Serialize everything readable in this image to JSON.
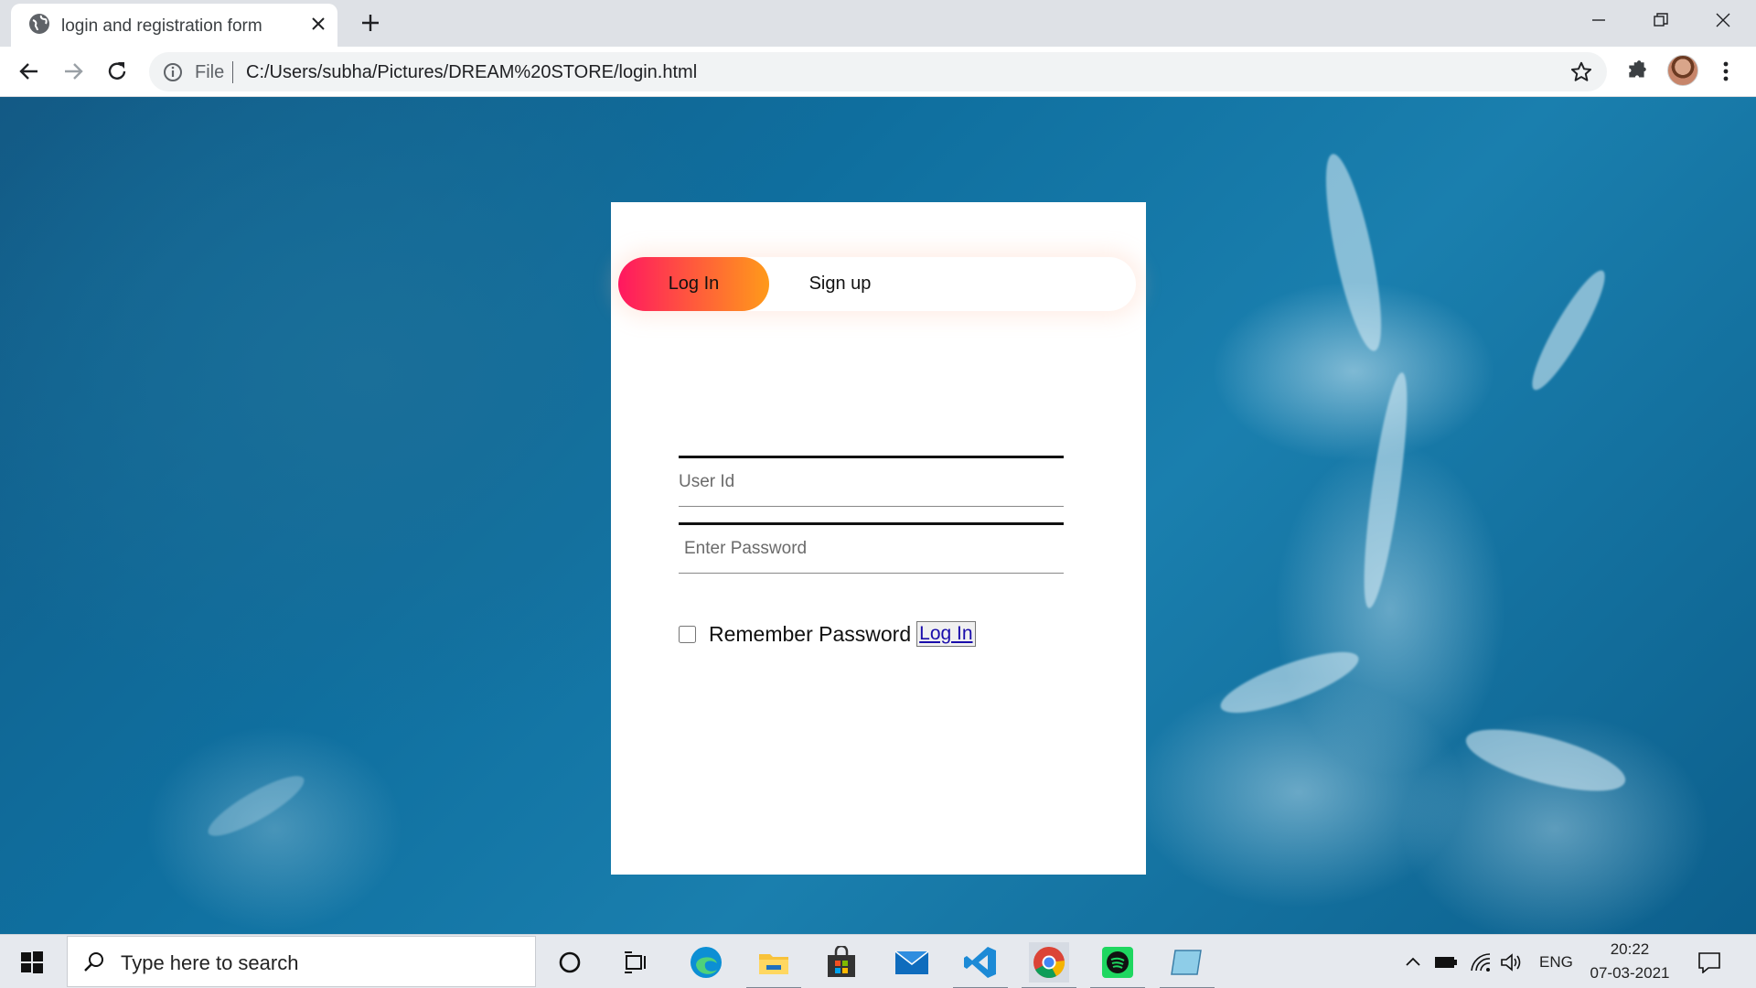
{
  "browser": {
    "tab_title": "login and registration form",
    "address_scheme": "File",
    "address_url": "C:/Users/subha/Pictures/DREAM%20STORE/login.html"
  },
  "page": {
    "toggle": {
      "login_label": "Log In",
      "signup_label": "Sign up"
    },
    "user_placeholder": "User Id",
    "password_placeholder": "Enter Password",
    "remember_label": "Remember Password",
    "login_link": "Log In",
    "colors": {
      "pill_start": "#ff1760",
      "pill_end": "#ff9a1a",
      "card": "#ffffff"
    }
  },
  "taskbar": {
    "search_placeholder": "Type here to search",
    "tray_lang": "ENG",
    "time": "20:22",
    "date": "07-03-2021"
  },
  "icons": [
    "globe-icon",
    "close-icon",
    "plus-icon",
    "minimize-icon",
    "restore-icon",
    "back-icon",
    "forward-icon",
    "reload-icon",
    "info-icon",
    "star-icon",
    "extensions-icon",
    "menu-icon",
    "windows-icon",
    "search-icon",
    "cortana-icon",
    "taskview-icon",
    "edge-icon",
    "explorer-icon",
    "store-icon",
    "mail-icon",
    "vscode-icon",
    "chrome-icon",
    "spotify-icon",
    "notepad-icon",
    "chevron-up-icon",
    "battery-icon",
    "wifi-icon",
    "volume-icon",
    "notification-icon"
  ]
}
